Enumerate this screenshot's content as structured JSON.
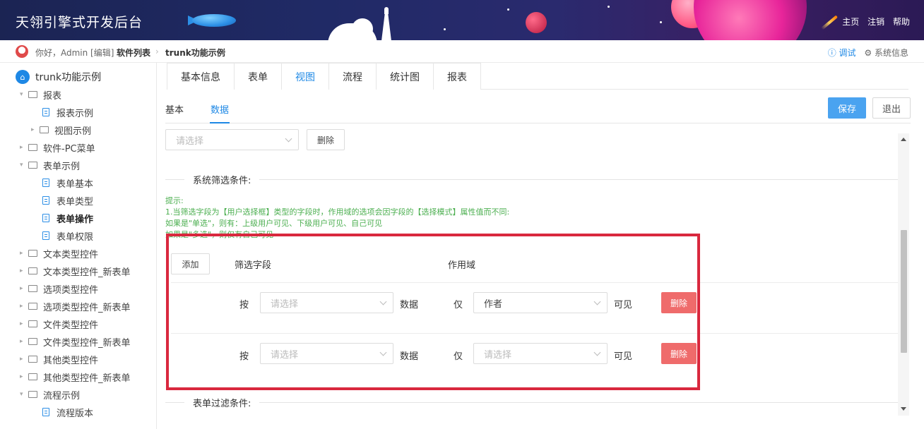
{
  "header": {
    "brand": "天翎引擎式开发后台",
    "links": [
      "主页",
      "注销",
      "帮助"
    ]
  },
  "breadcrumb": {
    "greeting": "你好，Admin [编辑]",
    "items": [
      "软件列表",
      "trunk功能示例"
    ],
    "debug": "调试",
    "system_info": "系统信息"
  },
  "sidebar": {
    "root": "trunk功能示例",
    "items": [
      {
        "label": "报表",
        "type": "folder-open"
      },
      {
        "label": "报表示例",
        "type": "doc"
      },
      {
        "label": "视图示例",
        "type": "folder"
      },
      {
        "label": "软件-PC菜单",
        "type": "folder"
      },
      {
        "label": "表单示例",
        "type": "folder-open"
      },
      {
        "label": "表单基本",
        "type": "doc"
      },
      {
        "label": "表单类型",
        "type": "doc"
      },
      {
        "label": "表单操作",
        "type": "doc",
        "active": true
      },
      {
        "label": "表单权限",
        "type": "doc"
      },
      {
        "label": "文本类型控件",
        "type": "folder"
      },
      {
        "label": "文本类型控件_新表单",
        "type": "folder"
      },
      {
        "label": "选项类型控件",
        "type": "folder"
      },
      {
        "label": "选项类型控件_新表单",
        "type": "folder"
      },
      {
        "label": "文件类型控件",
        "type": "folder"
      },
      {
        "label": "文件类型控件_新表单",
        "type": "folder"
      },
      {
        "label": "其他类型控件",
        "type": "folder"
      },
      {
        "label": "其他类型控件_新表单",
        "type": "folder"
      },
      {
        "label": "流程示例",
        "type": "folder-open"
      },
      {
        "label": "流程版本",
        "type": "doc"
      }
    ]
  },
  "tabs": [
    "基本信息",
    "表单",
    "视图",
    "流程",
    "统计图",
    "报表"
  ],
  "active_tab": "视图",
  "subtabs": [
    "基本",
    "数据"
  ],
  "buttons": {
    "save": "保存",
    "exit": "退出"
  },
  "top_row": {
    "select_placeholder": "请选择",
    "delete": "删除"
  },
  "system_filter": {
    "legend": "系统筛选条件:",
    "tips": [
      "提示:",
      "1.当筛选字段为【用户选择框】类型的字段时，作用域的选项会因字段的【选择模式】属性值而不同:",
      "如果是\"单选\"，则有：上级用户可见、下级用户可见、自己可见",
      "如果是\"多选\"，则仅有自己可见"
    ],
    "add_button": "添加",
    "col_field": "筛选字段",
    "col_scope": "作用域",
    "rows": [
      {
        "prefix": "按",
        "field_placeholder": "请选择",
        "mid": "数据",
        "only": "仅",
        "scope": "作者",
        "suffix": "可见",
        "delete": "删除"
      },
      {
        "prefix": "按",
        "field_placeholder": "请选择",
        "mid": "数据",
        "only": "仅",
        "scope_placeholder": "请选择",
        "suffix": "可见",
        "delete": "删除"
      }
    ]
  },
  "form_filter": {
    "legend": "表单过滤条件:"
  },
  "colors": {
    "accent": "#1e88e5",
    "danger": "#ef6b6b",
    "highlight": "#d9283e",
    "tip": "#4caf50"
  }
}
